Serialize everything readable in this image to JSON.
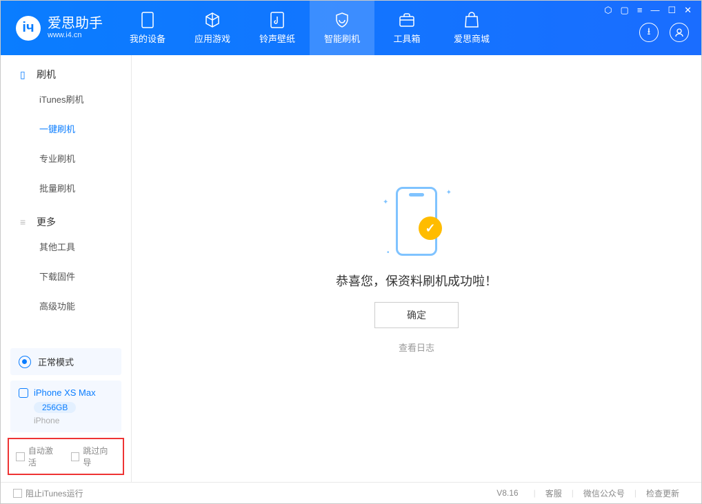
{
  "header": {
    "logo_title": "爱思助手",
    "logo_sub": "www.i4.cn",
    "nav": [
      {
        "label": "我的设备"
      },
      {
        "label": "应用游戏"
      },
      {
        "label": "铃声壁纸"
      },
      {
        "label": "智能刷机"
      },
      {
        "label": "工具箱"
      },
      {
        "label": "爱思商城"
      }
    ]
  },
  "sidebar": {
    "section1": {
      "title": "刷机",
      "items": [
        "iTunes刷机",
        "一键刷机",
        "专业刷机",
        "批量刷机"
      ]
    },
    "section2": {
      "title": "更多",
      "items": [
        "其他工具",
        "下载固件",
        "高级功能"
      ]
    },
    "mode": "正常模式",
    "device": {
      "name": "iPhone XS Max",
      "storage": "256GB",
      "type": "iPhone"
    },
    "checks": {
      "auto_activate": "自动激活",
      "skip_wizard": "跳过向导"
    }
  },
  "main": {
    "success_msg": "恭喜您，保资料刷机成功啦！",
    "ok_btn": "确定",
    "log_link": "查看日志"
  },
  "footer": {
    "block_itunes": "阻止iTunes运行",
    "version": "V8.16",
    "links": [
      "客服",
      "微信公众号",
      "检查更新"
    ]
  }
}
